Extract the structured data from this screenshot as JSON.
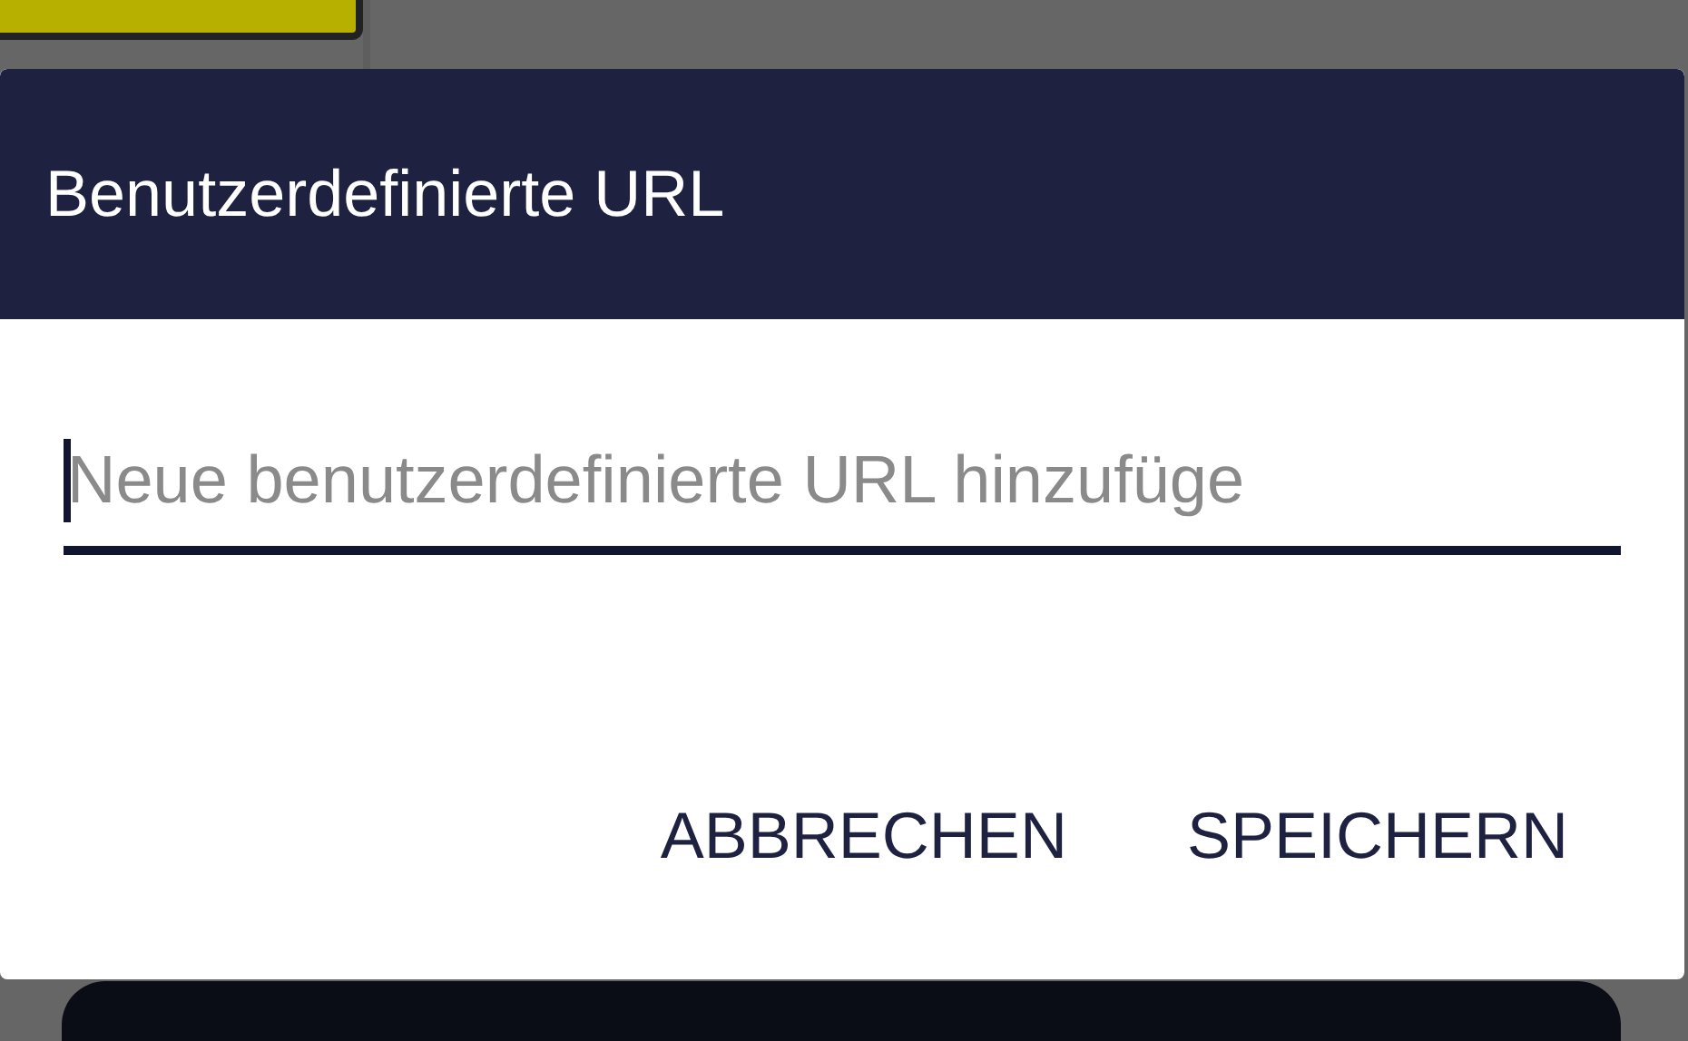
{
  "dialog": {
    "title": "Benutzerdefinierte URL",
    "url_field": {
      "placeholder": "Neue benutzerdefinierte URL hinzufüge",
      "focused": true
    },
    "buttons": [
      {
        "label": "ABBRECHEN"
      },
      {
        "label": "SPEICHERN"
      }
    ]
  }
}
